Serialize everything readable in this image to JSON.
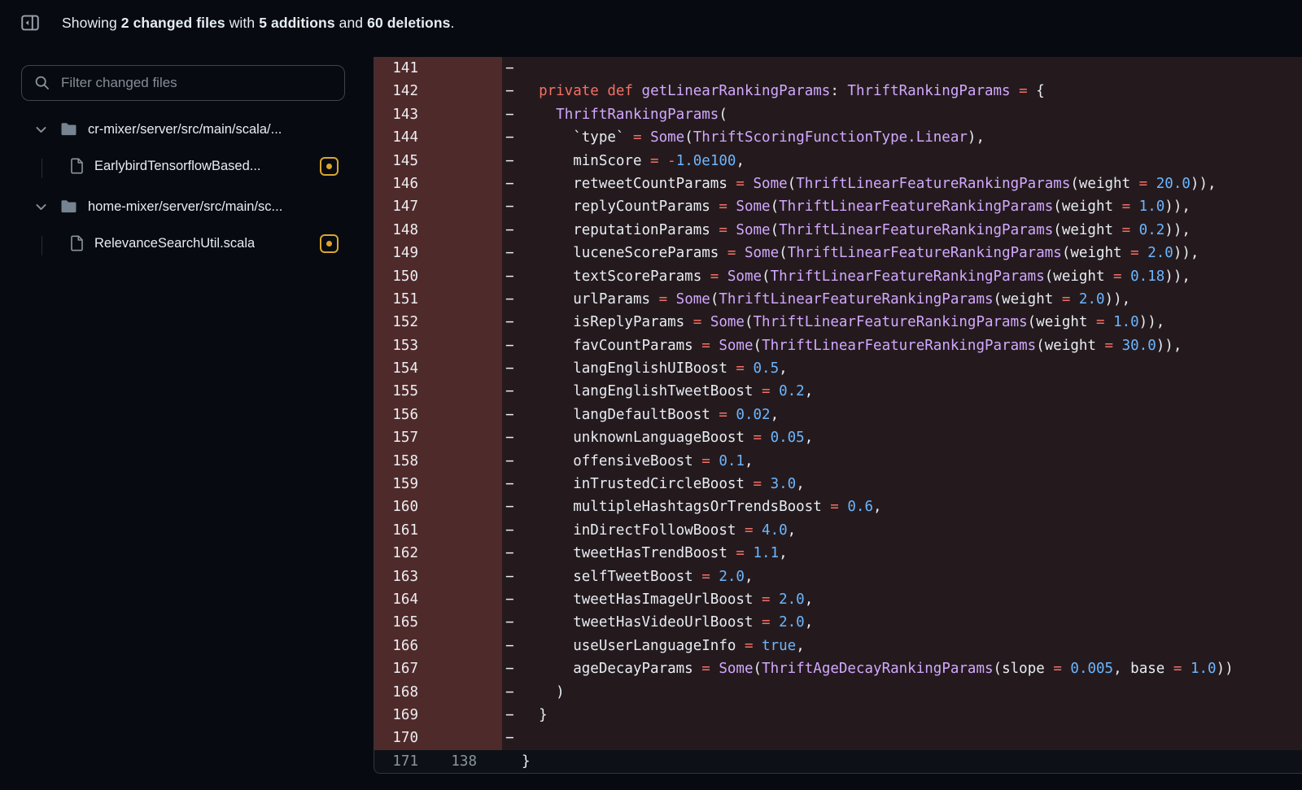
{
  "header": {
    "toggle_icon": "sidebar-collapse-icon",
    "parts": [
      {
        "text": "Showing ",
        "bold": false
      },
      {
        "text": "2 changed files",
        "bold": true
      },
      {
        "text": " with ",
        "bold": false
      },
      {
        "text": "5 additions",
        "bold": true
      },
      {
        "text": " and ",
        "bold": false
      },
      {
        "text": "60 deletions",
        "bold": true
      },
      {
        "text": ".",
        "bold": false
      }
    ]
  },
  "sidebar": {
    "filter_placeholder": "Filter changed files",
    "tree": [
      {
        "type": "folder",
        "label": "cr-mixer/server/src/main/scala/...",
        "children": [
          {
            "type": "file",
            "label": "EarlybirdTensorflowBased...",
            "status": "modified"
          }
        ]
      },
      {
        "type": "folder",
        "label": "home-mixer/server/src/main/sc...",
        "children": [
          {
            "type": "file",
            "label": "RelevanceSearchUtil.scala",
            "status": "modified"
          }
        ]
      }
    ]
  },
  "colors": {
    "page_bg": "#070a10",
    "panel_bg": "#0d1117",
    "deletion_gutter_bg": "#4f2a2b",
    "deletion_line_bg": "#241a1d",
    "modified_badge": "#d9a62e",
    "keyword": "#f47067",
    "entity": "#d2a8ff",
    "constant": "#6cb6ff",
    "text": "#e8edf3"
  },
  "diff": {
    "rows": [
      {
        "old": "141",
        "new": "",
        "type": "del",
        "tokens": []
      },
      {
        "old": "142",
        "new": "",
        "type": "del",
        "tokens": [
          [
            "  ",
            "p"
          ],
          [
            "private def",
            "k"
          ],
          [
            " ",
            "p"
          ],
          [
            "getLinearRankingParams",
            "e"
          ],
          [
            ": ",
            "p"
          ],
          [
            "ThriftRankingParams",
            "e"
          ],
          [
            " ",
            "p"
          ],
          [
            "=",
            "k"
          ],
          [
            " {",
            "p"
          ]
        ]
      },
      {
        "old": "143",
        "new": "",
        "type": "del",
        "tokens": [
          [
            "    ",
            "p"
          ],
          [
            "ThriftRankingParams",
            "e"
          ],
          [
            "(",
            "p"
          ]
        ]
      },
      {
        "old": "144",
        "new": "",
        "type": "del",
        "tokens": [
          [
            "      `type` ",
            "p"
          ],
          [
            "=",
            "k"
          ],
          [
            " ",
            "p"
          ],
          [
            "Some",
            "e"
          ],
          [
            "(",
            "p"
          ],
          [
            "ThriftScoringFunctionType.Linear",
            "e"
          ],
          [
            "),",
            "p"
          ]
        ]
      },
      {
        "old": "145",
        "new": "",
        "type": "del",
        "tokens": [
          [
            "      minScore ",
            "p"
          ],
          [
            "=",
            "k"
          ],
          [
            " ",
            "p"
          ],
          [
            "-",
            "k"
          ],
          [
            "1.0e100",
            "c"
          ],
          [
            ",",
            "p"
          ]
        ]
      },
      {
        "old": "146",
        "new": "",
        "type": "del",
        "tokens": [
          [
            "      retweetCountParams ",
            "p"
          ],
          [
            "=",
            "k"
          ],
          [
            " ",
            "p"
          ],
          [
            "Some",
            "e"
          ],
          [
            "(",
            "p"
          ],
          [
            "ThriftLinearFeatureRankingParams",
            "e"
          ],
          [
            "(weight ",
            "p"
          ],
          [
            "=",
            "k"
          ],
          [
            " ",
            "p"
          ],
          [
            "20.0",
            "c"
          ],
          [
            ")),",
            "p"
          ]
        ]
      },
      {
        "old": "147",
        "new": "",
        "type": "del",
        "tokens": [
          [
            "      replyCountParams ",
            "p"
          ],
          [
            "=",
            "k"
          ],
          [
            " ",
            "p"
          ],
          [
            "Some",
            "e"
          ],
          [
            "(",
            "p"
          ],
          [
            "ThriftLinearFeatureRankingParams",
            "e"
          ],
          [
            "(weight ",
            "p"
          ],
          [
            "=",
            "k"
          ],
          [
            " ",
            "p"
          ],
          [
            "1.0",
            "c"
          ],
          [
            ")),",
            "p"
          ]
        ]
      },
      {
        "old": "148",
        "new": "",
        "type": "del",
        "tokens": [
          [
            "      reputationParams ",
            "p"
          ],
          [
            "=",
            "k"
          ],
          [
            " ",
            "p"
          ],
          [
            "Some",
            "e"
          ],
          [
            "(",
            "p"
          ],
          [
            "ThriftLinearFeatureRankingParams",
            "e"
          ],
          [
            "(weight ",
            "p"
          ],
          [
            "=",
            "k"
          ],
          [
            " ",
            "p"
          ],
          [
            "0.2",
            "c"
          ],
          [
            ")),",
            "p"
          ]
        ]
      },
      {
        "old": "149",
        "new": "",
        "type": "del",
        "tokens": [
          [
            "      luceneScoreParams ",
            "p"
          ],
          [
            "=",
            "k"
          ],
          [
            " ",
            "p"
          ],
          [
            "Some",
            "e"
          ],
          [
            "(",
            "p"
          ],
          [
            "ThriftLinearFeatureRankingParams",
            "e"
          ],
          [
            "(weight ",
            "p"
          ],
          [
            "=",
            "k"
          ],
          [
            " ",
            "p"
          ],
          [
            "2.0",
            "c"
          ],
          [
            ")),",
            "p"
          ]
        ]
      },
      {
        "old": "150",
        "new": "",
        "type": "del",
        "tokens": [
          [
            "      textScoreParams ",
            "p"
          ],
          [
            "=",
            "k"
          ],
          [
            " ",
            "p"
          ],
          [
            "Some",
            "e"
          ],
          [
            "(",
            "p"
          ],
          [
            "ThriftLinearFeatureRankingParams",
            "e"
          ],
          [
            "(weight ",
            "p"
          ],
          [
            "=",
            "k"
          ],
          [
            " ",
            "p"
          ],
          [
            "0.18",
            "c"
          ],
          [
            ")),",
            "p"
          ]
        ]
      },
      {
        "old": "151",
        "new": "",
        "type": "del",
        "tokens": [
          [
            "      urlParams ",
            "p"
          ],
          [
            "=",
            "k"
          ],
          [
            " ",
            "p"
          ],
          [
            "Some",
            "e"
          ],
          [
            "(",
            "p"
          ],
          [
            "ThriftLinearFeatureRankingParams",
            "e"
          ],
          [
            "(weight ",
            "p"
          ],
          [
            "=",
            "k"
          ],
          [
            " ",
            "p"
          ],
          [
            "2.0",
            "c"
          ],
          [
            ")),",
            "p"
          ]
        ]
      },
      {
        "old": "152",
        "new": "",
        "type": "del",
        "tokens": [
          [
            "      isReplyParams ",
            "p"
          ],
          [
            "=",
            "k"
          ],
          [
            " ",
            "p"
          ],
          [
            "Some",
            "e"
          ],
          [
            "(",
            "p"
          ],
          [
            "ThriftLinearFeatureRankingParams",
            "e"
          ],
          [
            "(weight ",
            "p"
          ],
          [
            "=",
            "k"
          ],
          [
            " ",
            "p"
          ],
          [
            "1.0",
            "c"
          ],
          [
            ")),",
            "p"
          ]
        ]
      },
      {
        "old": "153",
        "new": "",
        "type": "del",
        "tokens": [
          [
            "      favCountParams ",
            "p"
          ],
          [
            "=",
            "k"
          ],
          [
            " ",
            "p"
          ],
          [
            "Some",
            "e"
          ],
          [
            "(",
            "p"
          ],
          [
            "ThriftLinearFeatureRankingParams",
            "e"
          ],
          [
            "(weight ",
            "p"
          ],
          [
            "=",
            "k"
          ],
          [
            " ",
            "p"
          ],
          [
            "30.0",
            "c"
          ],
          [
            ")),",
            "p"
          ]
        ]
      },
      {
        "old": "154",
        "new": "",
        "type": "del",
        "tokens": [
          [
            "      langEnglishUIBoost ",
            "p"
          ],
          [
            "=",
            "k"
          ],
          [
            " ",
            "p"
          ],
          [
            "0.5",
            "c"
          ],
          [
            ",",
            "p"
          ]
        ]
      },
      {
        "old": "155",
        "new": "",
        "type": "del",
        "tokens": [
          [
            "      langEnglishTweetBoost ",
            "p"
          ],
          [
            "=",
            "k"
          ],
          [
            " ",
            "p"
          ],
          [
            "0.2",
            "c"
          ],
          [
            ",",
            "p"
          ]
        ]
      },
      {
        "old": "156",
        "new": "",
        "type": "del",
        "tokens": [
          [
            "      langDefaultBoost ",
            "p"
          ],
          [
            "=",
            "k"
          ],
          [
            " ",
            "p"
          ],
          [
            "0.02",
            "c"
          ],
          [
            ",",
            "p"
          ]
        ]
      },
      {
        "old": "157",
        "new": "",
        "type": "del",
        "tokens": [
          [
            "      unknownLanguageBoost ",
            "p"
          ],
          [
            "=",
            "k"
          ],
          [
            " ",
            "p"
          ],
          [
            "0.05",
            "c"
          ],
          [
            ",",
            "p"
          ]
        ]
      },
      {
        "old": "158",
        "new": "",
        "type": "del",
        "tokens": [
          [
            "      offensiveBoost ",
            "p"
          ],
          [
            "=",
            "k"
          ],
          [
            " ",
            "p"
          ],
          [
            "0.1",
            "c"
          ],
          [
            ",",
            "p"
          ]
        ]
      },
      {
        "old": "159",
        "new": "",
        "type": "del",
        "tokens": [
          [
            "      inTrustedCircleBoost ",
            "p"
          ],
          [
            "=",
            "k"
          ],
          [
            " ",
            "p"
          ],
          [
            "3.0",
            "c"
          ],
          [
            ",",
            "p"
          ]
        ]
      },
      {
        "old": "160",
        "new": "",
        "type": "del",
        "tokens": [
          [
            "      multipleHashtagsOrTrendsBoost ",
            "p"
          ],
          [
            "=",
            "k"
          ],
          [
            " ",
            "p"
          ],
          [
            "0.6",
            "c"
          ],
          [
            ",",
            "p"
          ]
        ]
      },
      {
        "old": "161",
        "new": "",
        "type": "del",
        "tokens": [
          [
            "      inDirectFollowBoost ",
            "p"
          ],
          [
            "=",
            "k"
          ],
          [
            " ",
            "p"
          ],
          [
            "4.0",
            "c"
          ],
          [
            ",",
            "p"
          ]
        ]
      },
      {
        "old": "162",
        "new": "",
        "type": "del",
        "tokens": [
          [
            "      tweetHasTrendBoost ",
            "p"
          ],
          [
            "=",
            "k"
          ],
          [
            " ",
            "p"
          ],
          [
            "1.1",
            "c"
          ],
          [
            ",",
            "p"
          ]
        ]
      },
      {
        "old": "163",
        "new": "",
        "type": "del",
        "tokens": [
          [
            "      selfTweetBoost ",
            "p"
          ],
          [
            "=",
            "k"
          ],
          [
            " ",
            "p"
          ],
          [
            "2.0",
            "c"
          ],
          [
            ",",
            "p"
          ]
        ]
      },
      {
        "old": "164",
        "new": "",
        "type": "del",
        "tokens": [
          [
            "      tweetHasImageUrlBoost ",
            "p"
          ],
          [
            "=",
            "k"
          ],
          [
            " ",
            "p"
          ],
          [
            "2.0",
            "c"
          ],
          [
            ",",
            "p"
          ]
        ]
      },
      {
        "old": "165",
        "new": "",
        "type": "del",
        "tokens": [
          [
            "      tweetHasVideoUrlBoost ",
            "p"
          ],
          [
            "=",
            "k"
          ],
          [
            " ",
            "p"
          ],
          [
            "2.0",
            "c"
          ],
          [
            ",",
            "p"
          ]
        ]
      },
      {
        "old": "166",
        "new": "",
        "type": "del",
        "tokens": [
          [
            "      useUserLanguageInfo ",
            "p"
          ],
          [
            "=",
            "k"
          ],
          [
            " ",
            "p"
          ],
          [
            "true",
            "c"
          ],
          [
            ",",
            "p"
          ]
        ]
      },
      {
        "old": "167",
        "new": "",
        "type": "del",
        "tokens": [
          [
            "      ageDecayParams ",
            "p"
          ],
          [
            "=",
            "k"
          ],
          [
            " ",
            "p"
          ],
          [
            "Some",
            "e"
          ],
          [
            "(",
            "p"
          ],
          [
            "ThriftAgeDecayRankingParams",
            "e"
          ],
          [
            "(slope ",
            "p"
          ],
          [
            "=",
            "k"
          ],
          [
            " ",
            "p"
          ],
          [
            "0.005",
            "c"
          ],
          [
            ", base ",
            "p"
          ],
          [
            "=",
            "k"
          ],
          [
            " ",
            "p"
          ],
          [
            "1.0",
            "c"
          ],
          [
            "))",
            "p"
          ]
        ]
      },
      {
        "old": "168",
        "new": "",
        "type": "del",
        "tokens": [
          [
            "    )",
            "p"
          ]
        ]
      },
      {
        "old": "169",
        "new": "",
        "type": "del",
        "tokens": [
          [
            "  }",
            "p"
          ]
        ]
      },
      {
        "old": "170",
        "new": "",
        "type": "del",
        "tokens": []
      },
      {
        "old": "171",
        "new": "138",
        "type": "ctx",
        "tokens": [
          [
            "}",
            "p"
          ]
        ]
      }
    ]
  }
}
